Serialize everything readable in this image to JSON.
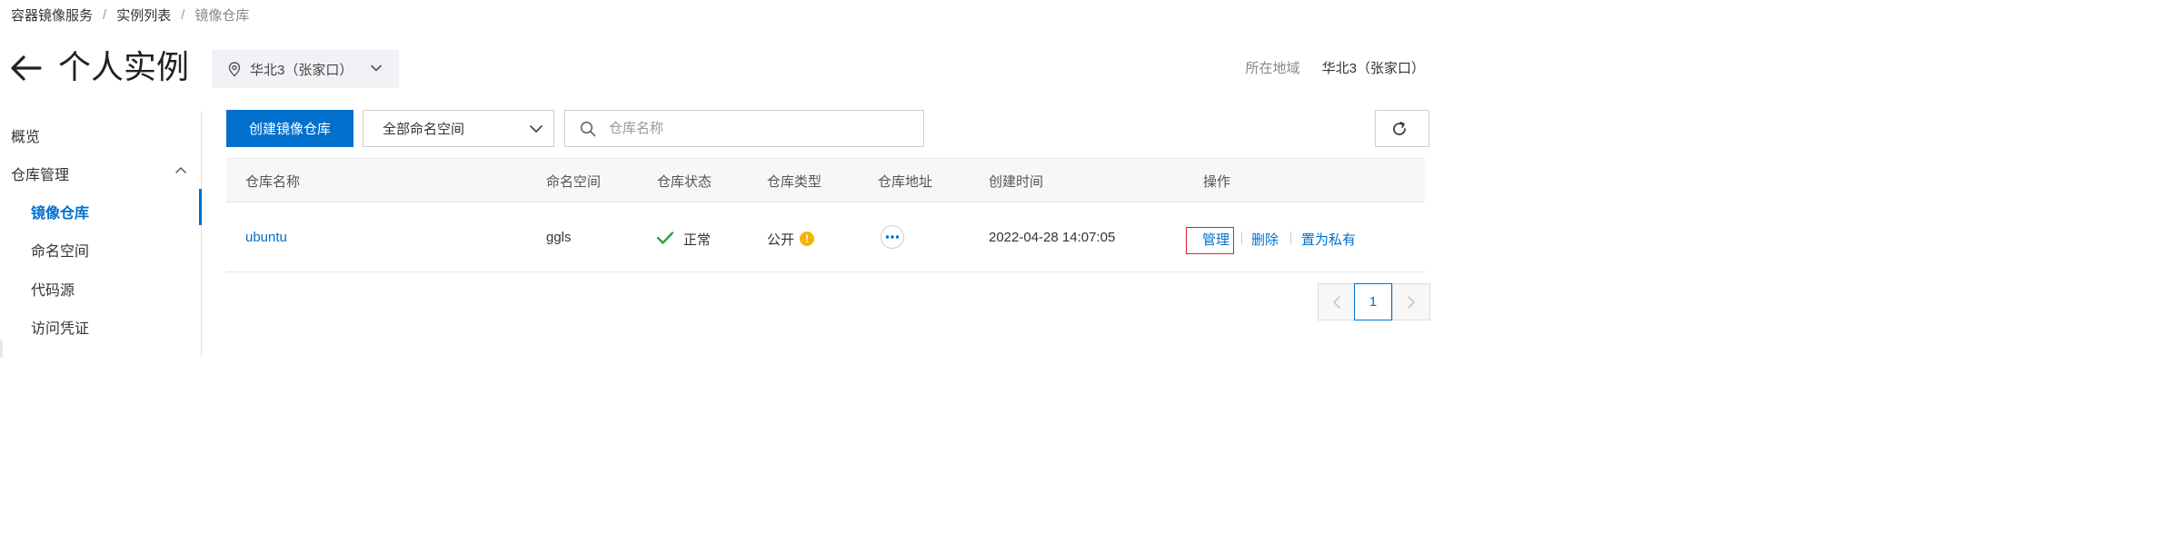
{
  "breadcrumb": {
    "items": [
      "容器镜像服务",
      "实例列表",
      "镜像仓库"
    ],
    "separator": "/"
  },
  "header": {
    "title": "个人实例",
    "region_select_value": "华北3（张家口）",
    "region_label": "所在地域",
    "region_value": "华北3（张家口）"
  },
  "sidebar": {
    "items": [
      {
        "label": "概览"
      },
      {
        "label": "仓库管理"
      },
      {
        "label": "镜像仓库"
      },
      {
        "label": "命名空间"
      },
      {
        "label": "代码源"
      },
      {
        "label": "访问凭证"
      }
    ]
  },
  "toolbar": {
    "create_label": "创建镜像仓库",
    "namespace_select_value": "全部命名空间",
    "search_placeholder": "仓库名称"
  },
  "table": {
    "headers": [
      "仓库名称",
      "命名空间",
      "仓库状态",
      "仓库类型",
      "仓库地址",
      "创建时间",
      "操作"
    ],
    "rows": [
      {
        "name": "ubuntu",
        "namespace": "ggls",
        "status": "正常",
        "type": "公开",
        "created": "2022-04-28 14:07:05",
        "actions": [
          "管理",
          "删除",
          "置为私有"
        ]
      }
    ]
  },
  "pagination": {
    "current": "1"
  },
  "colors": {
    "primary": "#0070cc",
    "success": "#2ba245",
    "warning": "#f5b400",
    "highlight_box": "#e02020"
  }
}
